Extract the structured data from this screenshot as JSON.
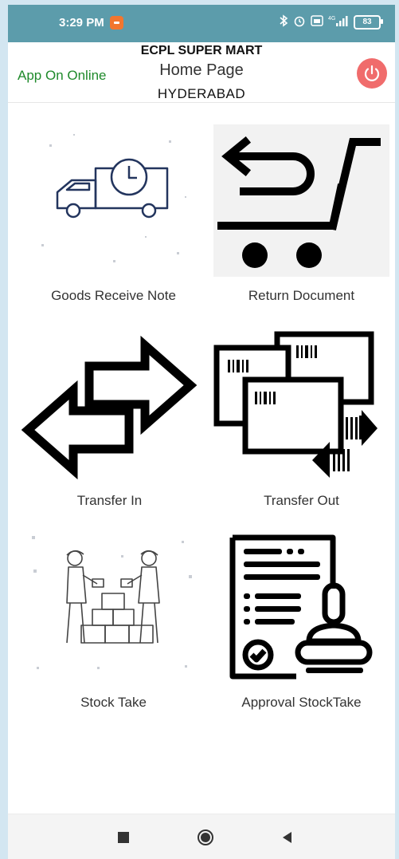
{
  "status_bar": {
    "time": "3:29 PM",
    "battery": "83",
    "network": "4G"
  },
  "header": {
    "online_status": "App On Online",
    "store_name": "ECPL SUPER MART",
    "page_title": "Home Page",
    "city": "HYDERABAD"
  },
  "menu": [
    {
      "label": "Goods Receive Note",
      "icon": "delivery-truck-clock-icon"
    },
    {
      "label": "Return Document",
      "icon": "cart-return-icon"
    },
    {
      "label": "Transfer In",
      "icon": "transfer-arrows-icon"
    },
    {
      "label": "Transfer Out",
      "icon": "boxes-transfer-icon"
    },
    {
      "label": "Stock Take",
      "icon": "workers-stock-icon"
    },
    {
      "label": "Approval StockTake",
      "icon": "approval-stamp-icon"
    }
  ],
  "colors": {
    "status_bar": "#5c9cab",
    "online_green": "#1f8a2b",
    "power_red": "#f06c6c"
  }
}
